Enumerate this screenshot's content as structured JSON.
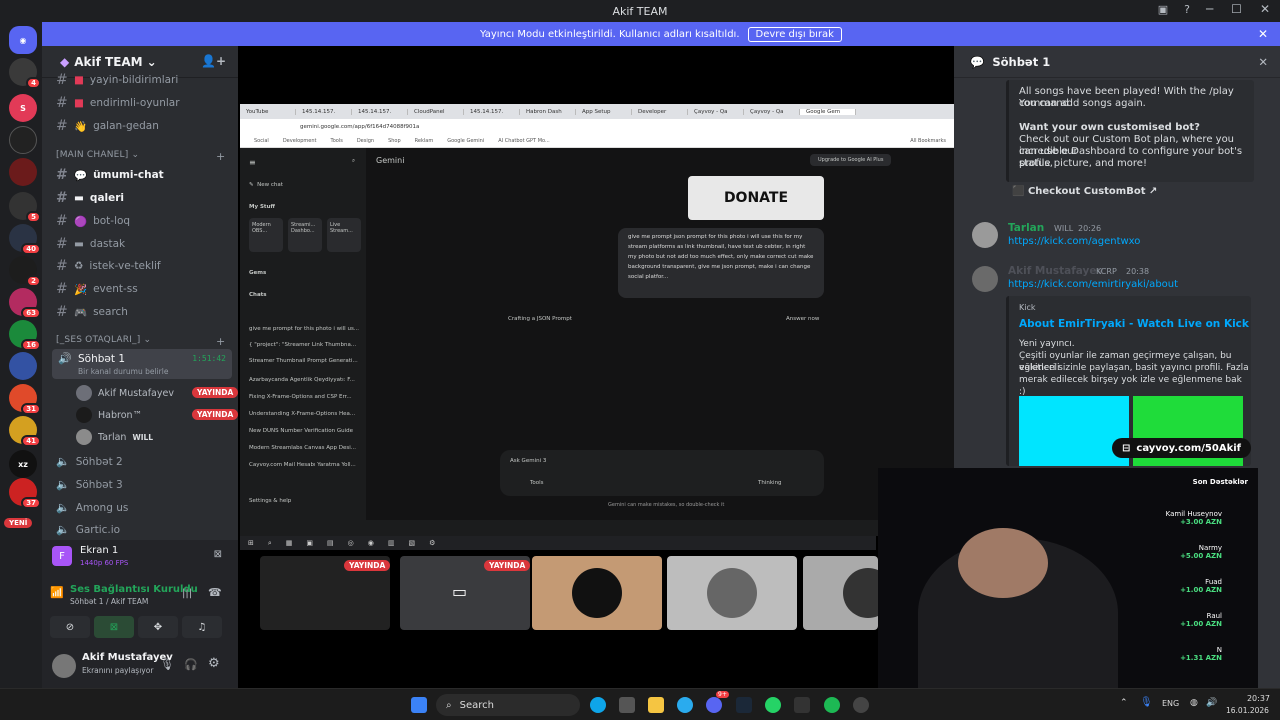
{
  "window": {
    "title": "Akif TEAM"
  },
  "banner": {
    "text": "Yayıncı Modu etkinleştirildi. Kullanıcı adları kısaltıldı.",
    "button": "Devre dışı bırak"
  },
  "guilds": {
    "badges": [
      "4",
      "5",
      "40",
      "2",
      "63",
      "16",
      "31",
      "41",
      "37"
    ],
    "new_label": "YENİ"
  },
  "server": {
    "name": "Akif TEAM",
    "text_channels": [
      "yayin-bildirimlari",
      "endirimli-oyunlar",
      "galan-gedan"
    ],
    "category_main": "[MAIN CHANEL]",
    "main_channels": [
      "ümumi-chat",
      "qaleri",
      "bot-loq",
      "dastak",
      "istek-ve-teklif",
      "event-ss",
      "search"
    ],
    "category_voice": "[_SES OTAQLARI_]",
    "active_voice": {
      "name": "Söhbət 1",
      "timer": "1:51:42",
      "status": "Bir kanal durumu belirle"
    },
    "voice_users": [
      {
        "name": "Akif Mustafayev",
        "badge": "YAYINDA"
      },
      {
        "name": "Habron™",
        "badge": "YAYINDA"
      },
      {
        "name": "Tarlan",
        "tag": "WILL"
      }
    ],
    "other_voice": [
      "Söhbət 2",
      "Söhbət 3",
      "Among us",
      "Gartic.io"
    ]
  },
  "stream_panel": {
    "title": "Ekran 1",
    "quality": "1440p 60 FPS"
  },
  "connection": {
    "title": "Ses Bağlantısı Kuruldu",
    "sub": "Söhbət 1 / Akif TEAM"
  },
  "user": {
    "name": "Akif Mustafayev",
    "status": "Ekranını paylaşıyor"
  },
  "browser": {
    "tabs": [
      "YouTube",
      "145.14.157.",
      "145.14.157.",
      "CloudPanel",
      "145.14.157.",
      "Habron Dash",
      "App Setup",
      "Developer",
      "Çayvoy - Qa",
      "Çayvoy - Qa",
      "Google Gem"
    ],
    "url": "gemini.google.com/app/6f164d74088f901a",
    "bookmarks": [
      "Social",
      "Development",
      "Tools",
      "Design",
      "Shop",
      "Reklam",
      "Google Gemini",
      "AI Chatbot GPT Mo..."
    ],
    "all_bookmarks": "All Bookmarks",
    "app_title": "Gemini",
    "upgrade": "Upgrade to Google AI Plus",
    "new_chat": "New chat",
    "my_stuff": "My Stuff",
    "stuff_items": [
      "Modern OBS...",
      "Streami... Dashbo...",
      "Live Stream..."
    ],
    "gems": "Gems",
    "chats": "Chats",
    "chat_list": [
      "give me prompt for this photo i will us...",
      "{ \"project\": \"Streamer Link Thumbna...",
      "Streamer Thumbnail Prompt Generati...",
      "Azarbaycanda Agentlik Qeydiyyatı: F...",
      "Fixing X-Frame-Options and CSP Err...",
      "Understanding X-Frame-Options Hea...",
      "New DUNS Number Verification Guide",
      "Modern Streamlabs Canvas App Desi...",
      "Cayvoy.com Mail Hesabı Yaratma Yoll..."
    ],
    "settings": "Settings & help",
    "donate_img": "DONATE",
    "prompt": "give me prompt json prompt for this photo i will use this for my stream platforms as link thumbnail, have text ub cebter, in right my photo but not add too much effect, only make correct cut make background transparent, give me json prompt, make i can change social platfor...",
    "crafting": "Crafting a JSON Prompt",
    "answer_now": "Answer now",
    "input_placeholder": "Ask Gemini 3",
    "tools": "Tools",
    "thinking": "Thinking",
    "disclaimer": "Gemini can make mistakes, so double-check it"
  },
  "streams": {
    "live_badge": "YAYINDA"
  },
  "right": {
    "title": "Söhbət 1",
    "embed1_lines": [
      "All songs have been played! With the /play command",
      "You can add songs again."
    ],
    "embed1_heading": "Want your own customised bot?",
    "embed1_body": [
      "Check out our Custom Bot plan, where you can use our",
      "incredible Dashboard to configure your bot's status,",
      "profile picture, and more!"
    ],
    "checkout": "Checkout CustomBot",
    "msgs": [
      {
        "name": "Tarlan",
        "tag": "WILL",
        "time": "20:26",
        "link": "https://kick.com/agentwxo"
      },
      {
        "name": "Akif Mustafayev",
        "tag": "KCRP",
        "time": "20:38",
        "link": "https://kick.com/emirtiryaki/about"
      }
    ],
    "kick_embed": {
      "provider": "Kick",
      "title": "About EmirTiryaki - Watch Live on Kick",
      "desc": [
        "Yeni yayıncı.",
        "Çeşitli oyunlar ile zaman geçirmeye çalışan, bu eğlenceli",
        "vakitleri sizinle paylaşan, basit yayıncı profili. Fazla",
        "merak edilecek birşey yok izle ve eğlenmene bak :)"
      ]
    }
  },
  "overlay": {
    "link": "cayvoy.com/50Akif",
    "donations_title": "Son Dəstəklər",
    "donations": [
      {
        "name": "Kamil Huseynov",
        "amount": "+3.00 AZN"
      },
      {
        "name": "Narmy",
        "amount": "+5.00 AZN"
      },
      {
        "name": "Fuad",
        "amount": "+1.00 AZN"
      },
      {
        "name": "Raul",
        "amount": "+1.00 AZN"
      },
      {
        "name": "N",
        "amount": "+1.31 AZN"
      }
    ]
  },
  "taskbar": {
    "search": "Search",
    "lang": "ENG",
    "time": "20:37",
    "date": "16.01.2026",
    "discord_badge": "9+"
  }
}
